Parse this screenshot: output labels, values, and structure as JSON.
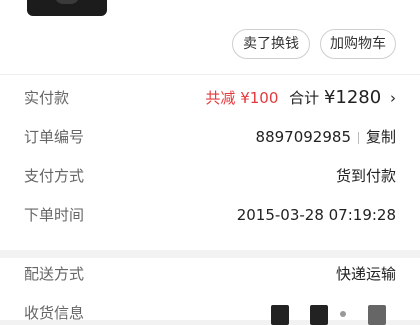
{
  "actions": {
    "sell_label": "卖了换钱",
    "cart_label": "加购物车"
  },
  "order_info": {
    "paid_label": "实付款",
    "discount": "共减 ¥100",
    "total_prefix": "合计",
    "total_amount": "¥1280",
    "order_no_label": "订单编号",
    "order_no": "8897092985",
    "copy_label": "复制",
    "payment_label": "支付方式",
    "payment_value": "货到付款",
    "order_time_label": "下单时间",
    "order_time": "2015-03-28 07:19:28"
  },
  "delivery_info": {
    "shipping_label": "配送方式",
    "shipping_value": "快递运输",
    "receiver_label": "收货信息"
  }
}
